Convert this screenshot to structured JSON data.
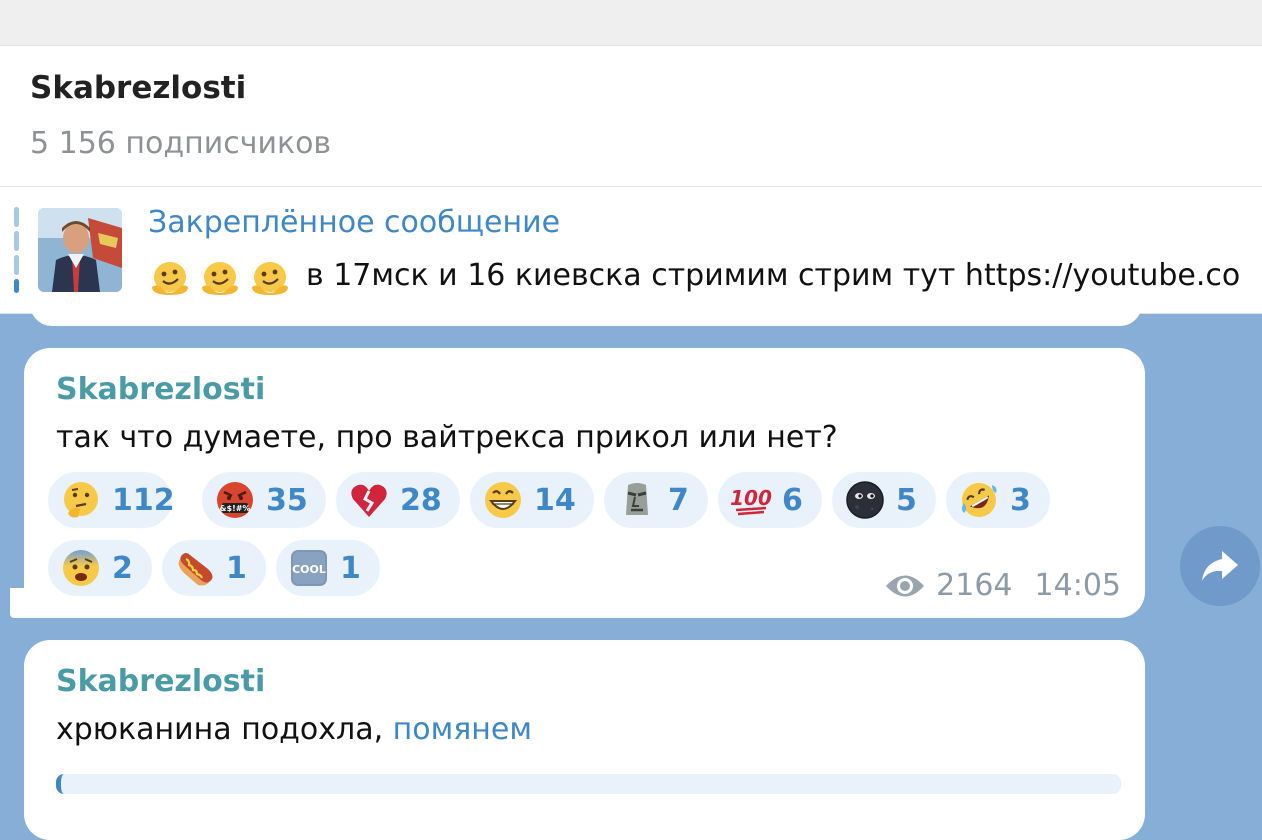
{
  "channel": {
    "title": "Skabrezlosti",
    "subscribers": "5 156 подписчиков"
  },
  "pinned": {
    "title": "Закреплённое сообщение",
    "emoji_icon": "melting-face",
    "emoji_count": 3,
    "text": "в 17мск и 16 киевска стримим стрим тут https://youtube.co"
  },
  "messages": [
    {
      "author": "Skabrezlosti",
      "text": "так что думаете, про вайтрекса прикол или нет?",
      "reactions": [
        {
          "icon": "thinking-face",
          "count": "112"
        },
        {
          "icon": "cursing-face",
          "count": "35"
        },
        {
          "icon": "broken-heart",
          "count": "28"
        },
        {
          "icon": "grinning-face",
          "count": "14"
        },
        {
          "icon": "moai",
          "count": "7"
        },
        {
          "icon": "hundred-points",
          "count": "6"
        },
        {
          "icon": "new-moon-face",
          "count": "5"
        },
        {
          "icon": "rofl-face",
          "count": "3"
        },
        {
          "icon": "fearful-face",
          "count": "2"
        },
        {
          "icon": "hot-dog",
          "count": "1"
        },
        {
          "icon": "cool-button",
          "count": "1"
        }
      ],
      "views": "2164",
      "time": "14:05"
    },
    {
      "author": "Skabrezlosti",
      "text": "хрюканина подохла, ",
      "link": "помянем"
    }
  ],
  "colors": {
    "accent": "#3f87c7",
    "author": "#4a9ba6",
    "chat_background": "#86aed7",
    "reaction_bg": "#e9f2fb"
  }
}
